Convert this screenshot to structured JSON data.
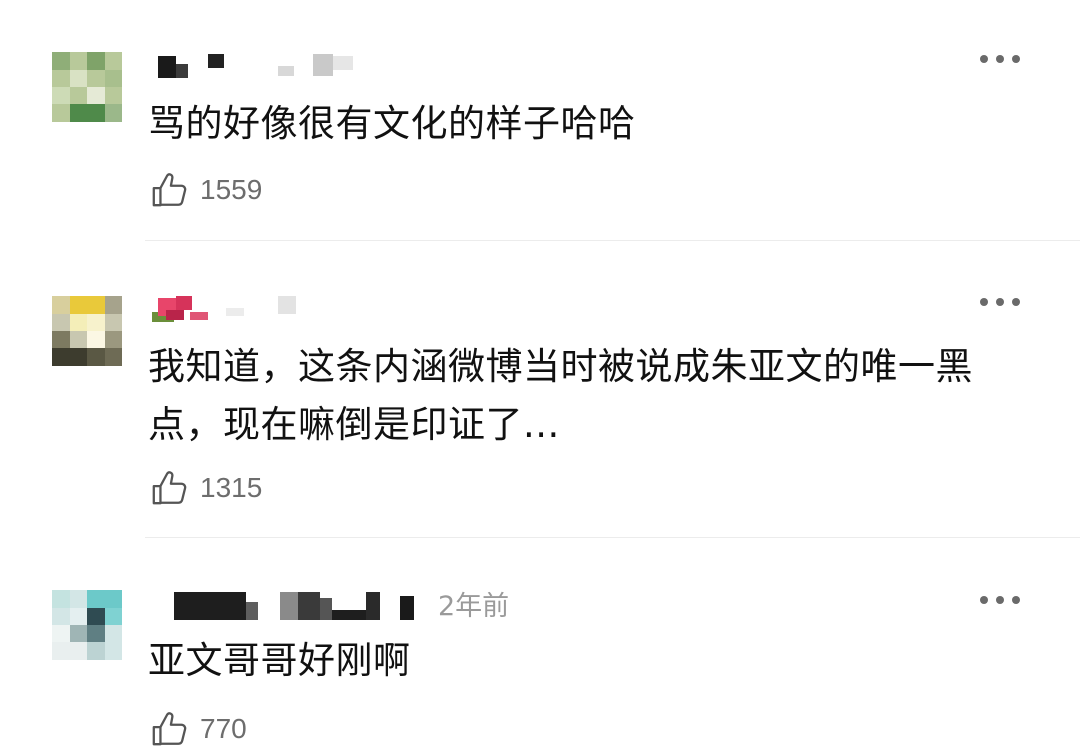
{
  "comments": [
    {
      "text": "骂的好像很有文化的样子哈哈",
      "likes": "1559",
      "time": ""
    },
    {
      "text": "我知道，这条内涵微博当时被说成朱亚文的唯一黑点，现在嘛倒是印证了...",
      "likes": "1315",
      "time": ""
    },
    {
      "text": "亚文哥哥好刚啊",
      "likes": "770",
      "time": "2年前"
    }
  ],
  "icons": {
    "like": "thumbs-up-icon",
    "more": "more-dots-icon"
  },
  "colors": {
    "text": "#111111",
    "meta": "#9a9a9a",
    "divider": "#ececec"
  }
}
